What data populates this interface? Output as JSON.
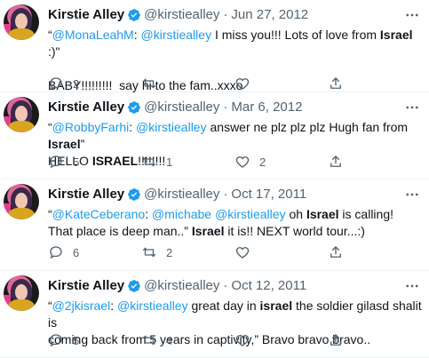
{
  "author": {
    "name": "Kirstie Alley",
    "handle": "@kirstiealley",
    "separator": "·"
  },
  "tweets": [
    {
      "date": "Jun 27, 2012",
      "line1_parts": [
        "“",
        "@MonaLeahM",
        ": ",
        "@kirstiealley",
        " I miss you!!! Lots of love from ",
        "Israel",
        " :)\""
      ],
      "line2": "",
      "line3": "BABY!!!!!!!!!  say hi to the fam..xxxo",
      "replies": "2",
      "retweets": "",
      "likes": ""
    },
    {
      "date": "Mar 6, 2012",
      "line1_parts": [
        "“",
        "@RobbyFarhi",
        ": ",
        "@kirstiealley",
        " answer ne plz plz plz Hugh fan from ",
        "Israel",
        "”"
      ],
      "line2_parts": [
        "HELLO ",
        "ISRAEL",
        "!!!!!!!!"
      ],
      "replies": "5",
      "retweets": "1",
      "likes": "2"
    },
    {
      "date": "Oct 17, 2011",
      "line1_parts": [
        "“",
        "@KateCeberano",
        ": ",
        "@michabe",
        " ",
        "@kirstiealley",
        " oh ",
        "Israel",
        " is calling!"
      ],
      "line2_parts": [
        "That place is deep man..” ",
        "Israel",
        " it is!! NEXT world tour...:)"
      ],
      "replies": "6",
      "retweets": "2",
      "likes": ""
    },
    {
      "date": "Oct 12, 2011",
      "line1_parts": [
        "“",
        "@2jkisrael",
        ": ",
        "@kirstiealley",
        " great day in ",
        "israel",
        " the soldier gilasd shalit is"
      ],
      "line2": "coming back from 5 years in captivity,” Bravo bravo bravo..",
      "replies": "5",
      "retweets": "4",
      "likes": ""
    }
  ],
  "icons": {
    "reply": "reply-icon",
    "retweet": "retweet-icon",
    "like": "like-icon",
    "share": "share-icon",
    "more": "more-icon",
    "verified": "verified-badge-icon"
  },
  "colors": {
    "link": "#1d9bf0",
    "text": "#0f1419",
    "secondary": "#536471",
    "divider": "#eff3f4"
  }
}
